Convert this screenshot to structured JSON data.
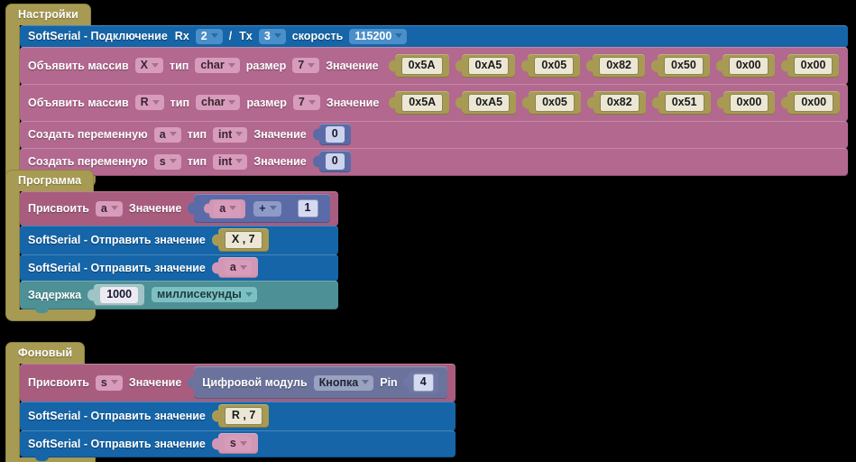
{
  "app": {
    "background_color": "#000000",
    "language": "ru"
  },
  "palette": {
    "section_hat": "#a79a53",
    "serial_blue": "#1565a8",
    "array_mauve": "#b3688f",
    "variable_mauve": "#b3688f",
    "assign_mauve": "#a85d7f",
    "delay_teal": "#4d9196",
    "math_slate": "#5b6ba8",
    "module_grey": "#6b739c",
    "value_khaki": "#a79a53",
    "value_pink": "#d197b4"
  },
  "sections": [
    {
      "id": "settings",
      "label": "Настройки",
      "blocks": [
        {
          "kind": "serial_begin",
          "label": "SoftSerial - Подключение",
          "rx_label": "Rx",
          "rx_value": "2",
          "separator": "/",
          "tx_label": "Tx",
          "tx_value": "3",
          "speed_label": "скорость",
          "speed_value": "115200"
        },
        {
          "kind": "array_declare",
          "label": "Объявить массив",
          "name": "X",
          "type_label": "тип",
          "type_value": "char",
          "size_label": "размер",
          "size_value": "7",
          "value_label": "Значение",
          "values": [
            "0x5A",
            "0xA5",
            "0x05",
            "0x82",
            "0x50",
            "0x00",
            "0x00"
          ]
        },
        {
          "kind": "array_declare",
          "label": "Объявить массив",
          "name": "R",
          "type_label": "тип",
          "type_value": "char",
          "size_label": "размер",
          "size_value": "7",
          "value_label": "Значение",
          "values": [
            "0x5A",
            "0xA5",
            "0x05",
            "0x82",
            "0x51",
            "0x00",
            "0x00"
          ]
        },
        {
          "kind": "var_declare",
          "label": "Создать переменную",
          "name": "a",
          "type_label": "тип",
          "type_value": "int",
          "value_label": "Значение",
          "value": "0"
        },
        {
          "kind": "var_declare",
          "label": "Создать переменную",
          "name": "s",
          "type_label": "тип",
          "type_value": "int",
          "value_label": "Значение",
          "value": "0"
        }
      ]
    },
    {
      "id": "program",
      "label": "Программа",
      "blocks": [
        {
          "kind": "assign_math",
          "label": "Присвоить",
          "name": "a",
          "value_label": "Значение",
          "operand_left": "a",
          "operator": "+",
          "operand_right": "1"
        },
        {
          "kind": "serial_send",
          "label": "SoftSerial - Отправить значение",
          "value_kind": "array_ref",
          "value": "X , 7"
        },
        {
          "kind": "serial_send",
          "label": "SoftSerial - Отправить значение",
          "value_kind": "variable",
          "value": "a"
        },
        {
          "kind": "delay",
          "label": "Задержка",
          "amount": "1000",
          "unit": "миллисекунды"
        }
      ]
    },
    {
      "id": "background",
      "label": "Фоновый",
      "blocks": [
        {
          "kind": "assign_module",
          "label": "Присвоить",
          "name": "s",
          "value_label": "Значение",
          "module_label": "Цифровой модуль",
          "module_value": "Кнопка",
          "pin_label": "Pin",
          "pin_value": "4"
        },
        {
          "kind": "serial_send",
          "label": "SoftSerial - Отправить значение",
          "value_kind": "array_ref",
          "value": "R , 7"
        },
        {
          "kind": "serial_send",
          "label": "SoftSerial - Отправить значение",
          "value_kind": "variable",
          "value": "s"
        }
      ]
    }
  ]
}
